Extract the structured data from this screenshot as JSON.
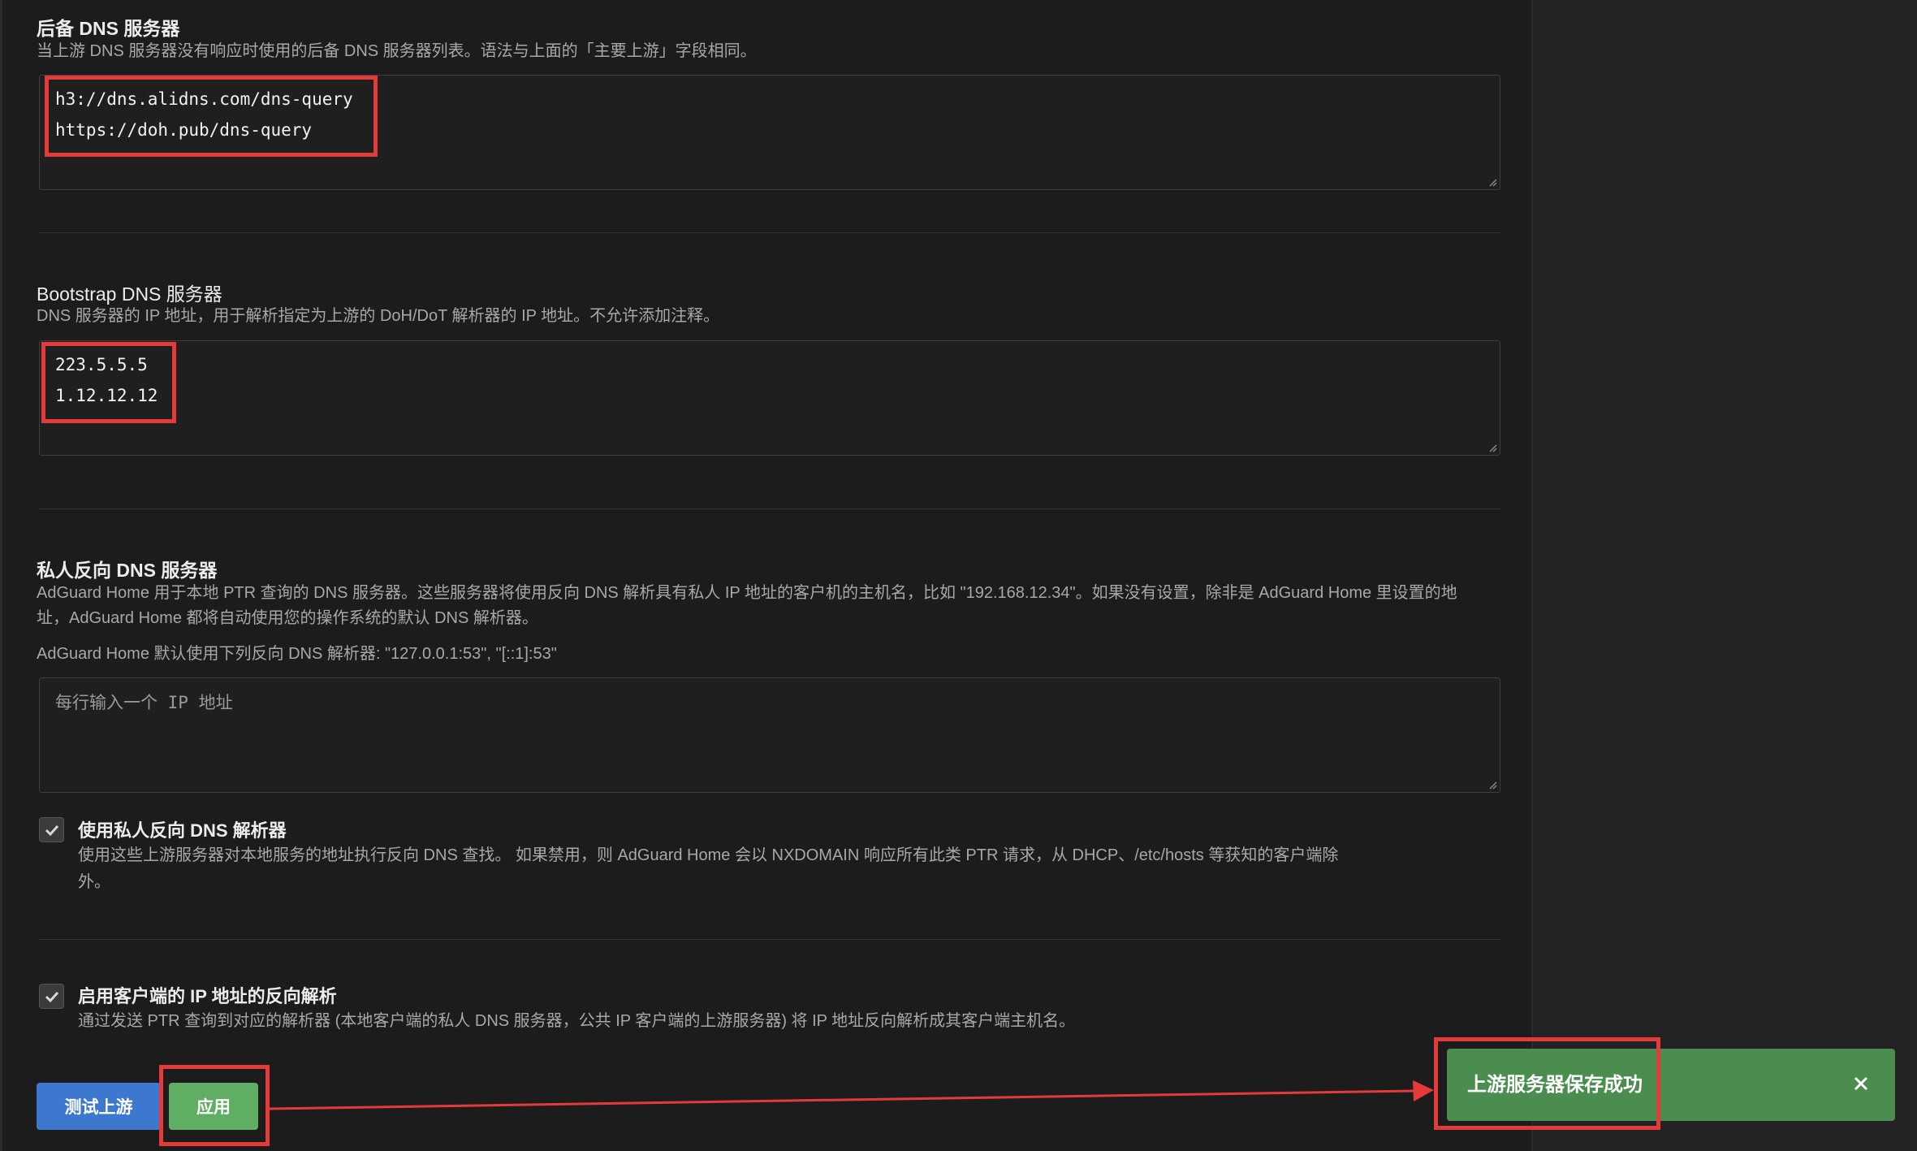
{
  "fallback_dns": {
    "title": "后备 DNS 服务器",
    "description": "当上游 DNS 服务器没有响应时使用的后备 DNS 服务器列表。语法与上面的「主要上游」字段相同。",
    "lines": [
      "h3://dns.alidns.com/dns-query",
      "https://doh.pub/dns-query"
    ]
  },
  "bootstrap_dns": {
    "title": "Bootstrap DNS 服务器",
    "description": "DNS 服务器的 IP 地址，用于解析指定为上游的 DoH/DoT 解析器的 IP 地址。不允许添加注释。",
    "lines": [
      "223.5.5.5",
      "1.12.12.12"
    ]
  },
  "private_reverse_dns": {
    "title": "私人反向 DNS 服务器",
    "description_line1": "AdGuard Home 用于本地 PTR 查询的 DNS 服务器。这些服务器将使用反向 DNS 解析具有私人 IP 地址的客户机的主机名，比如 \"192.168.12.34\"。如果没有设置，除非是 AdGuard Home 里设置的地",
    "description_line2": "址，AdGuard Home 都将自动使用您的操作系统的默认 DNS 解析器。",
    "default_note": "AdGuard Home 默认使用下列反向 DNS 解析器: \"127.0.0.1:53\", \"[::1]:53\"",
    "placeholder": "每行输入一个 IP 地址"
  },
  "use_private_reverse": {
    "label": "使用私人反向 DNS 解析器",
    "description_line1": "使用这些上游服务器对本地服务的地址执行反向 DNS 查找。 如果禁用，则 AdGuard Home 会以 NXDOMAIN 响应所有此类 PTR 请求，从 DHCP、/etc/hosts 等获知的客户端除",
    "description_line2": "外。",
    "checked": true
  },
  "enable_client_rdns": {
    "label": "启用客户端的 IP 地址的反向解析",
    "description": "通过发送 PTR 查询到对应的解析器 (本地客户端的私人 DNS 服务器，公共 IP 客户端的上游服务器) 将 IP 地址反向解析成其客户端主机名。",
    "checked": true
  },
  "buttons": {
    "test_upstream": "测试上游",
    "apply": "应用"
  },
  "toast": {
    "message": "上游服务器保存成功",
    "close_icon": "close-icon"
  },
  "colors": {
    "highlight": "#e43a3a",
    "test_button": "#3c78d0",
    "apply_button": "#5fae64",
    "toast": "#4b8d4f"
  }
}
